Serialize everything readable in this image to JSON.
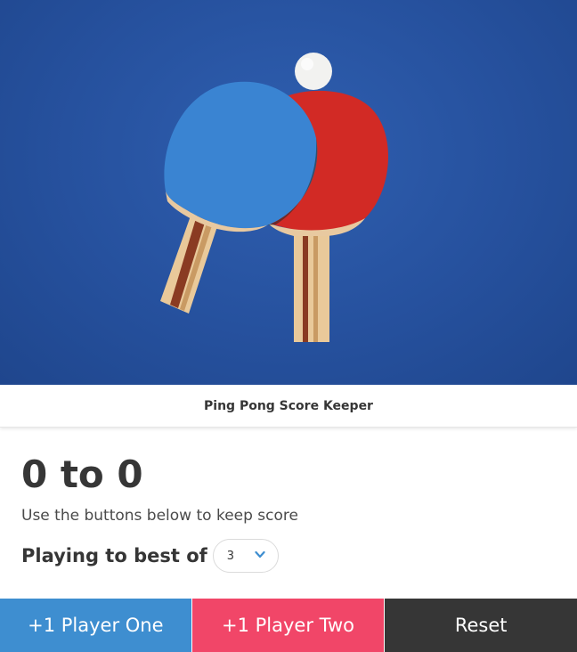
{
  "hero": {
    "image": "ping-pong-paddles-and-ball"
  },
  "card": {
    "title": "Ping Pong Score Keeper"
  },
  "score": {
    "player_one": "0",
    "separator": "to",
    "player_two": "0",
    "text": "0 to 0"
  },
  "hint": "Use the buttons below to keep score",
  "best_of": {
    "label": "Playing to best of",
    "selected": "3",
    "icon": "chevron-down-icon"
  },
  "buttons": {
    "player_one": "+1 Player One",
    "player_two": "+1 Player Two",
    "reset": "Reset"
  },
  "colors": {
    "player_one": "#3e8ed0",
    "player_two": "#f14668",
    "reset": "#363636",
    "table": "#26519e"
  }
}
